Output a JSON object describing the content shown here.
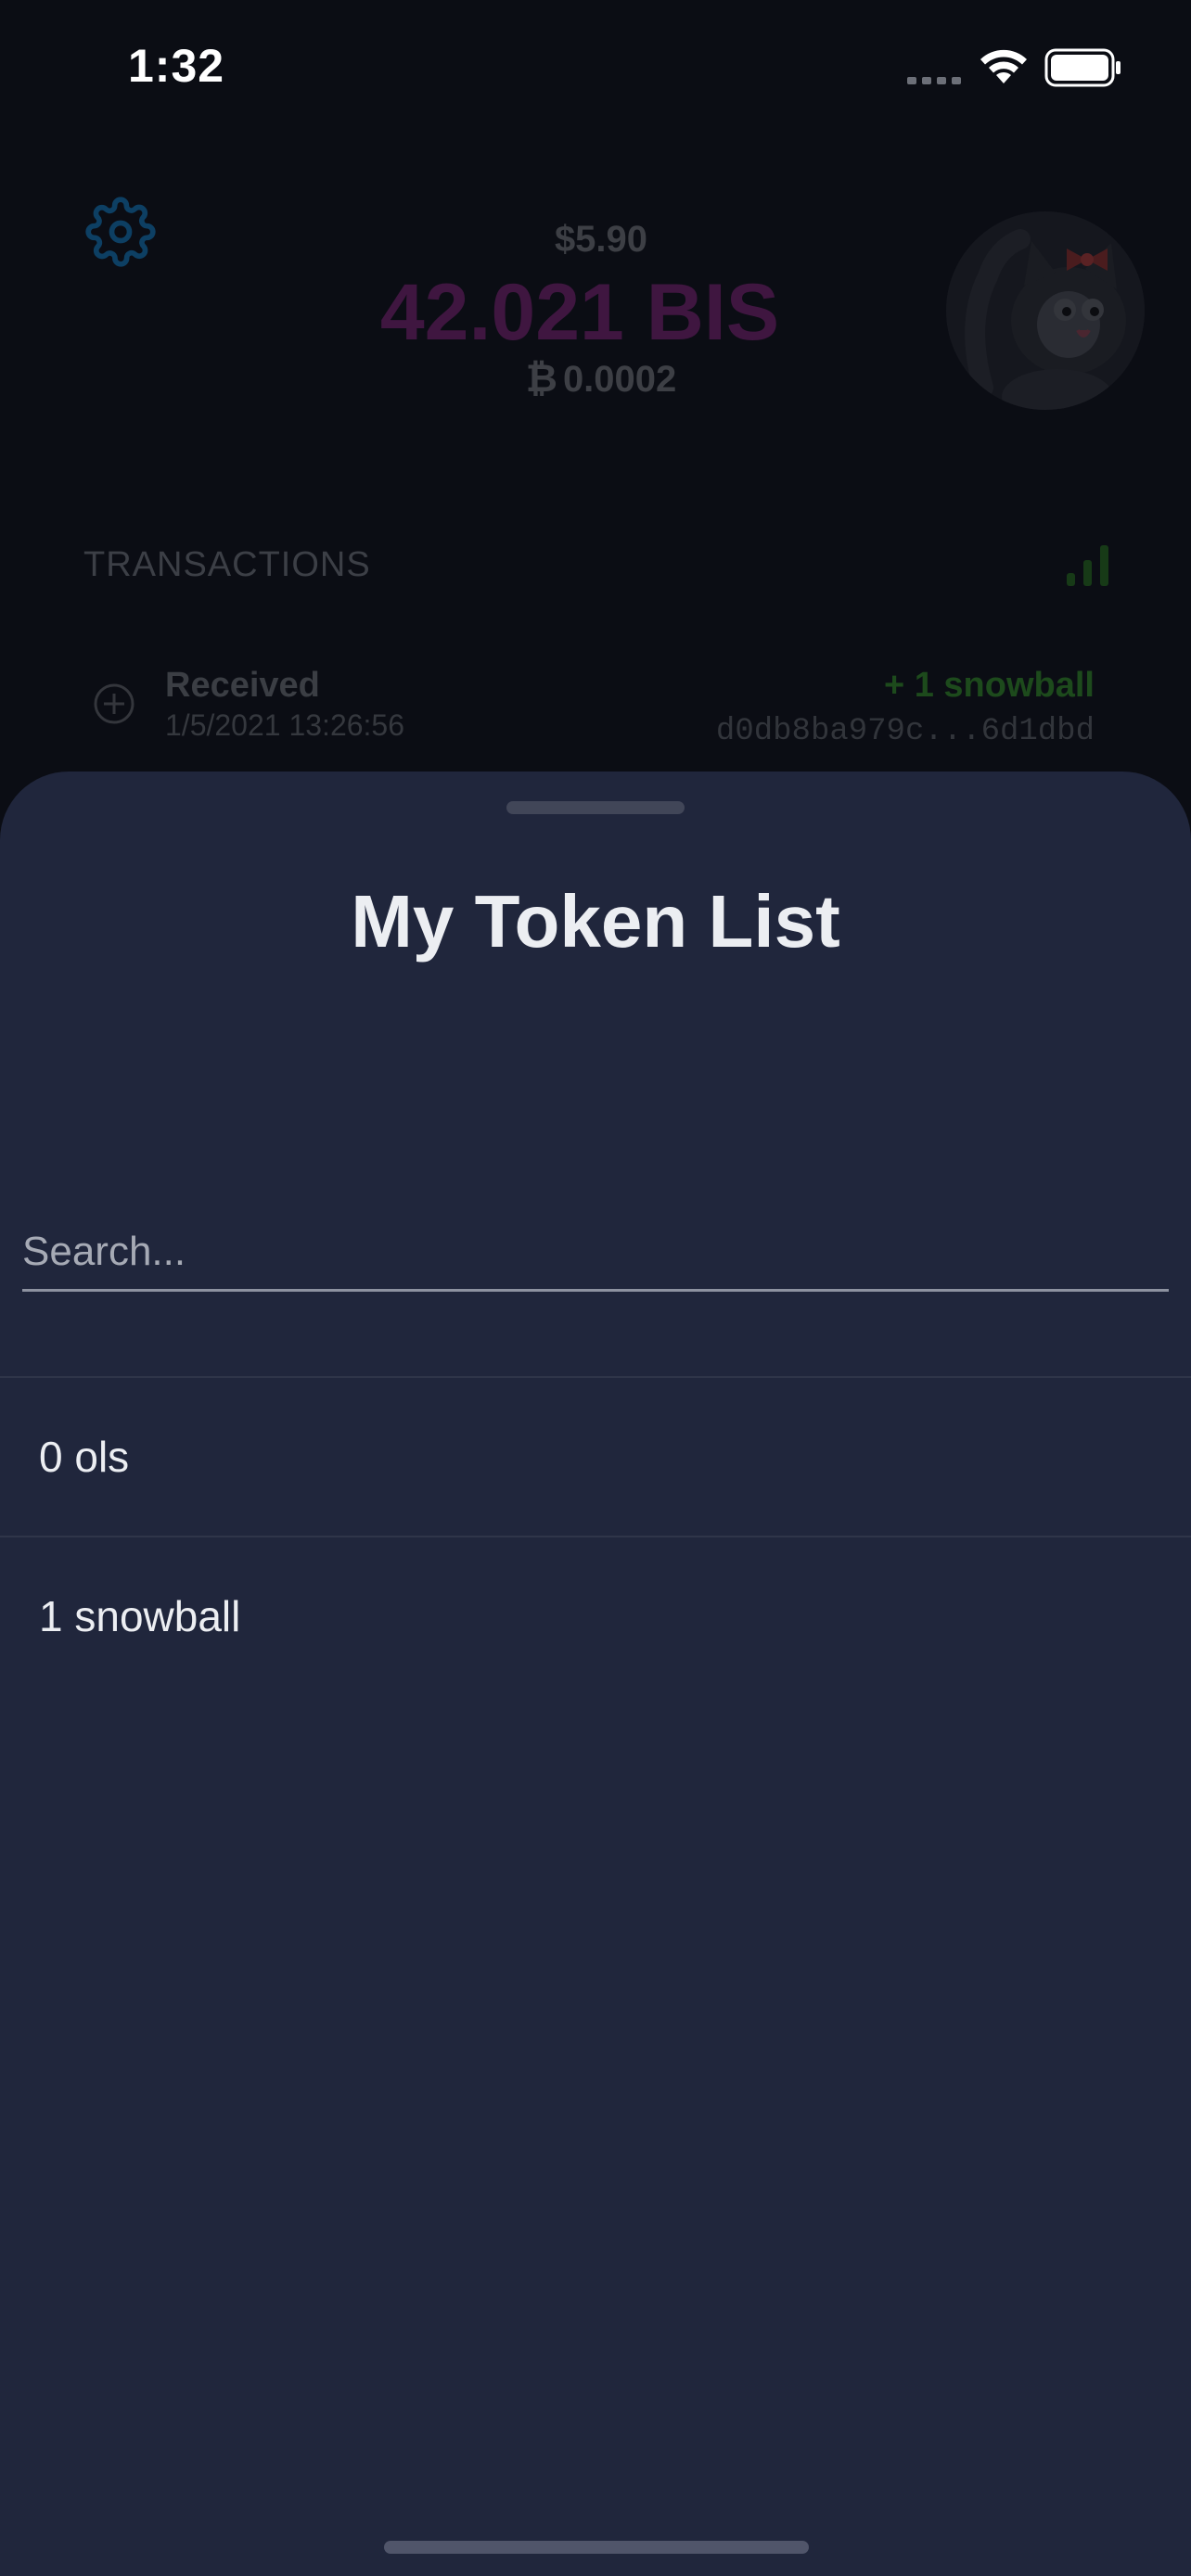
{
  "status_bar": {
    "time": "1:32"
  },
  "wallet": {
    "balance_usd": "$5.90",
    "balance_main": "42.021 BIS",
    "balance_btc_symbol": "₿",
    "balance_btc": "0.0002",
    "transactions_header": "TRANSACTIONS",
    "transaction": {
      "type": "Received",
      "date": "1/5/2021 13:26:56",
      "amount": "+ 1 snowball",
      "hash": "d0db8ba979c...6d1dbd"
    }
  },
  "sheet": {
    "title": "My Token List",
    "search_placeholder": "Search...",
    "tokens": [
      {
        "label": "0 ols"
      },
      {
        "label": "1 snowball"
      }
    ]
  },
  "colors": {
    "sheet_background": "#20263c",
    "screen_background": "#0b0d14",
    "balance_accent": "#3f1640",
    "received_green": "#1d4a1c"
  }
}
